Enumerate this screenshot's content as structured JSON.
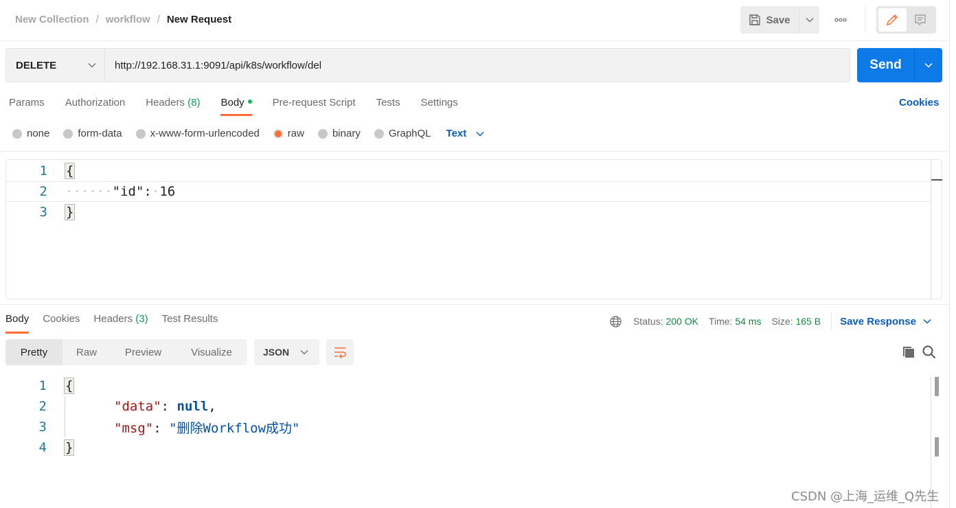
{
  "breadcrumb": {
    "items": [
      "New Collection",
      "workflow"
    ],
    "separator": "/",
    "current": "New Request"
  },
  "toolbar": {
    "save_label": "Save",
    "more_icon": "ellipsis-icon",
    "modes": [
      {
        "name": "edit",
        "icon": "pencil-icon",
        "active": true
      },
      {
        "name": "comments",
        "icon": "comment-icon",
        "active": false
      }
    ]
  },
  "request": {
    "method": "DELETE",
    "url": "http://192.168.31.1:9091/api/k8s/workflow/del",
    "send_label": "Send",
    "cookies_label": "Cookies",
    "tabs": [
      {
        "label": "Params"
      },
      {
        "label": "Authorization"
      },
      {
        "label": "Headers",
        "count": "(8)"
      },
      {
        "label": "Body",
        "active": true,
        "has_dot": true
      },
      {
        "label": "Pre-request Script"
      },
      {
        "label": "Tests"
      },
      {
        "label": "Settings"
      }
    ],
    "body_types": [
      {
        "label": "none",
        "checked": false
      },
      {
        "label": "form-data",
        "checked": false
      },
      {
        "label": "x-www-form-urlencoded",
        "checked": false
      },
      {
        "label": "raw",
        "checked": true
      },
      {
        "label": "binary",
        "checked": false
      },
      {
        "label": "GraphQL",
        "checked": false
      }
    ],
    "raw_format": "Text",
    "body_lines": [
      {
        "num": "1",
        "text": "{"
      },
      {
        "num": "2",
        "indent": "······",
        "key": "\"id\"",
        "colon": ":",
        "sp": "·",
        "value": "16"
      },
      {
        "num": "3",
        "text": "}"
      }
    ]
  },
  "response": {
    "tabs": [
      {
        "label": "Body",
        "active": true
      },
      {
        "label": "Cookies"
      },
      {
        "label": "Headers",
        "count": "(3)"
      },
      {
        "label": "Test Results"
      }
    ],
    "status_label": "Status:",
    "status_value": "200 OK",
    "time_label": "Time:",
    "time_value": "54 ms",
    "size_label": "Size:",
    "size_value": "165 B",
    "save_response_label": "Save Response",
    "view_modes": [
      "Pretty",
      "Raw",
      "Preview",
      "Visualize"
    ],
    "active_view": "Pretty",
    "format": "JSON",
    "body_lines": [
      {
        "num": "1",
        "text": "{"
      },
      {
        "num": "2",
        "key": "\"data\"",
        "colon": ": ",
        "value": "null",
        "trail": ","
      },
      {
        "num": "3",
        "key": "\"msg\"",
        "colon": ": ",
        "value": "\"删除Workflow成功\""
      },
      {
        "num": "4",
        "text": "}"
      }
    ]
  },
  "colors": {
    "accent_orange": "#ff6c37",
    "send_blue": "#0d7ae8",
    "link_blue": "#0b5cbf",
    "status_green": "#0f8a3f"
  },
  "watermark": "CSDN @上海_运维_Q先生"
}
